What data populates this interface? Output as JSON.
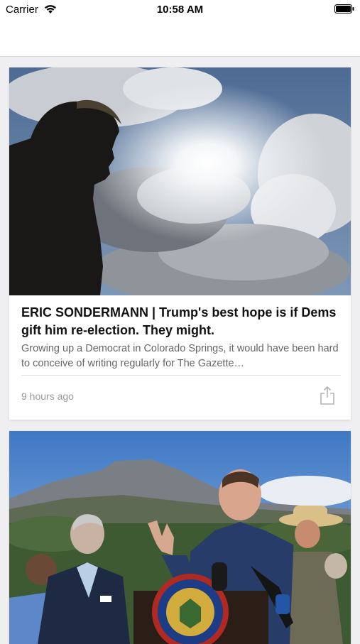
{
  "status_bar": {
    "carrier": "Carrier",
    "time": "10:58 AM"
  },
  "articles": [
    {
      "headline": "ERIC SONDERMANN | Trump's best hope is if Dems gift him re-election. They might.",
      "summary": "Growing up a Democrat in Colorado Springs, it would have been hard to conceive of writing regularly for The Gazette…",
      "timestamp": "9 hours ago"
    },
    {
      "image_seal_text": "STATE OF COLORADO"
    }
  ]
}
